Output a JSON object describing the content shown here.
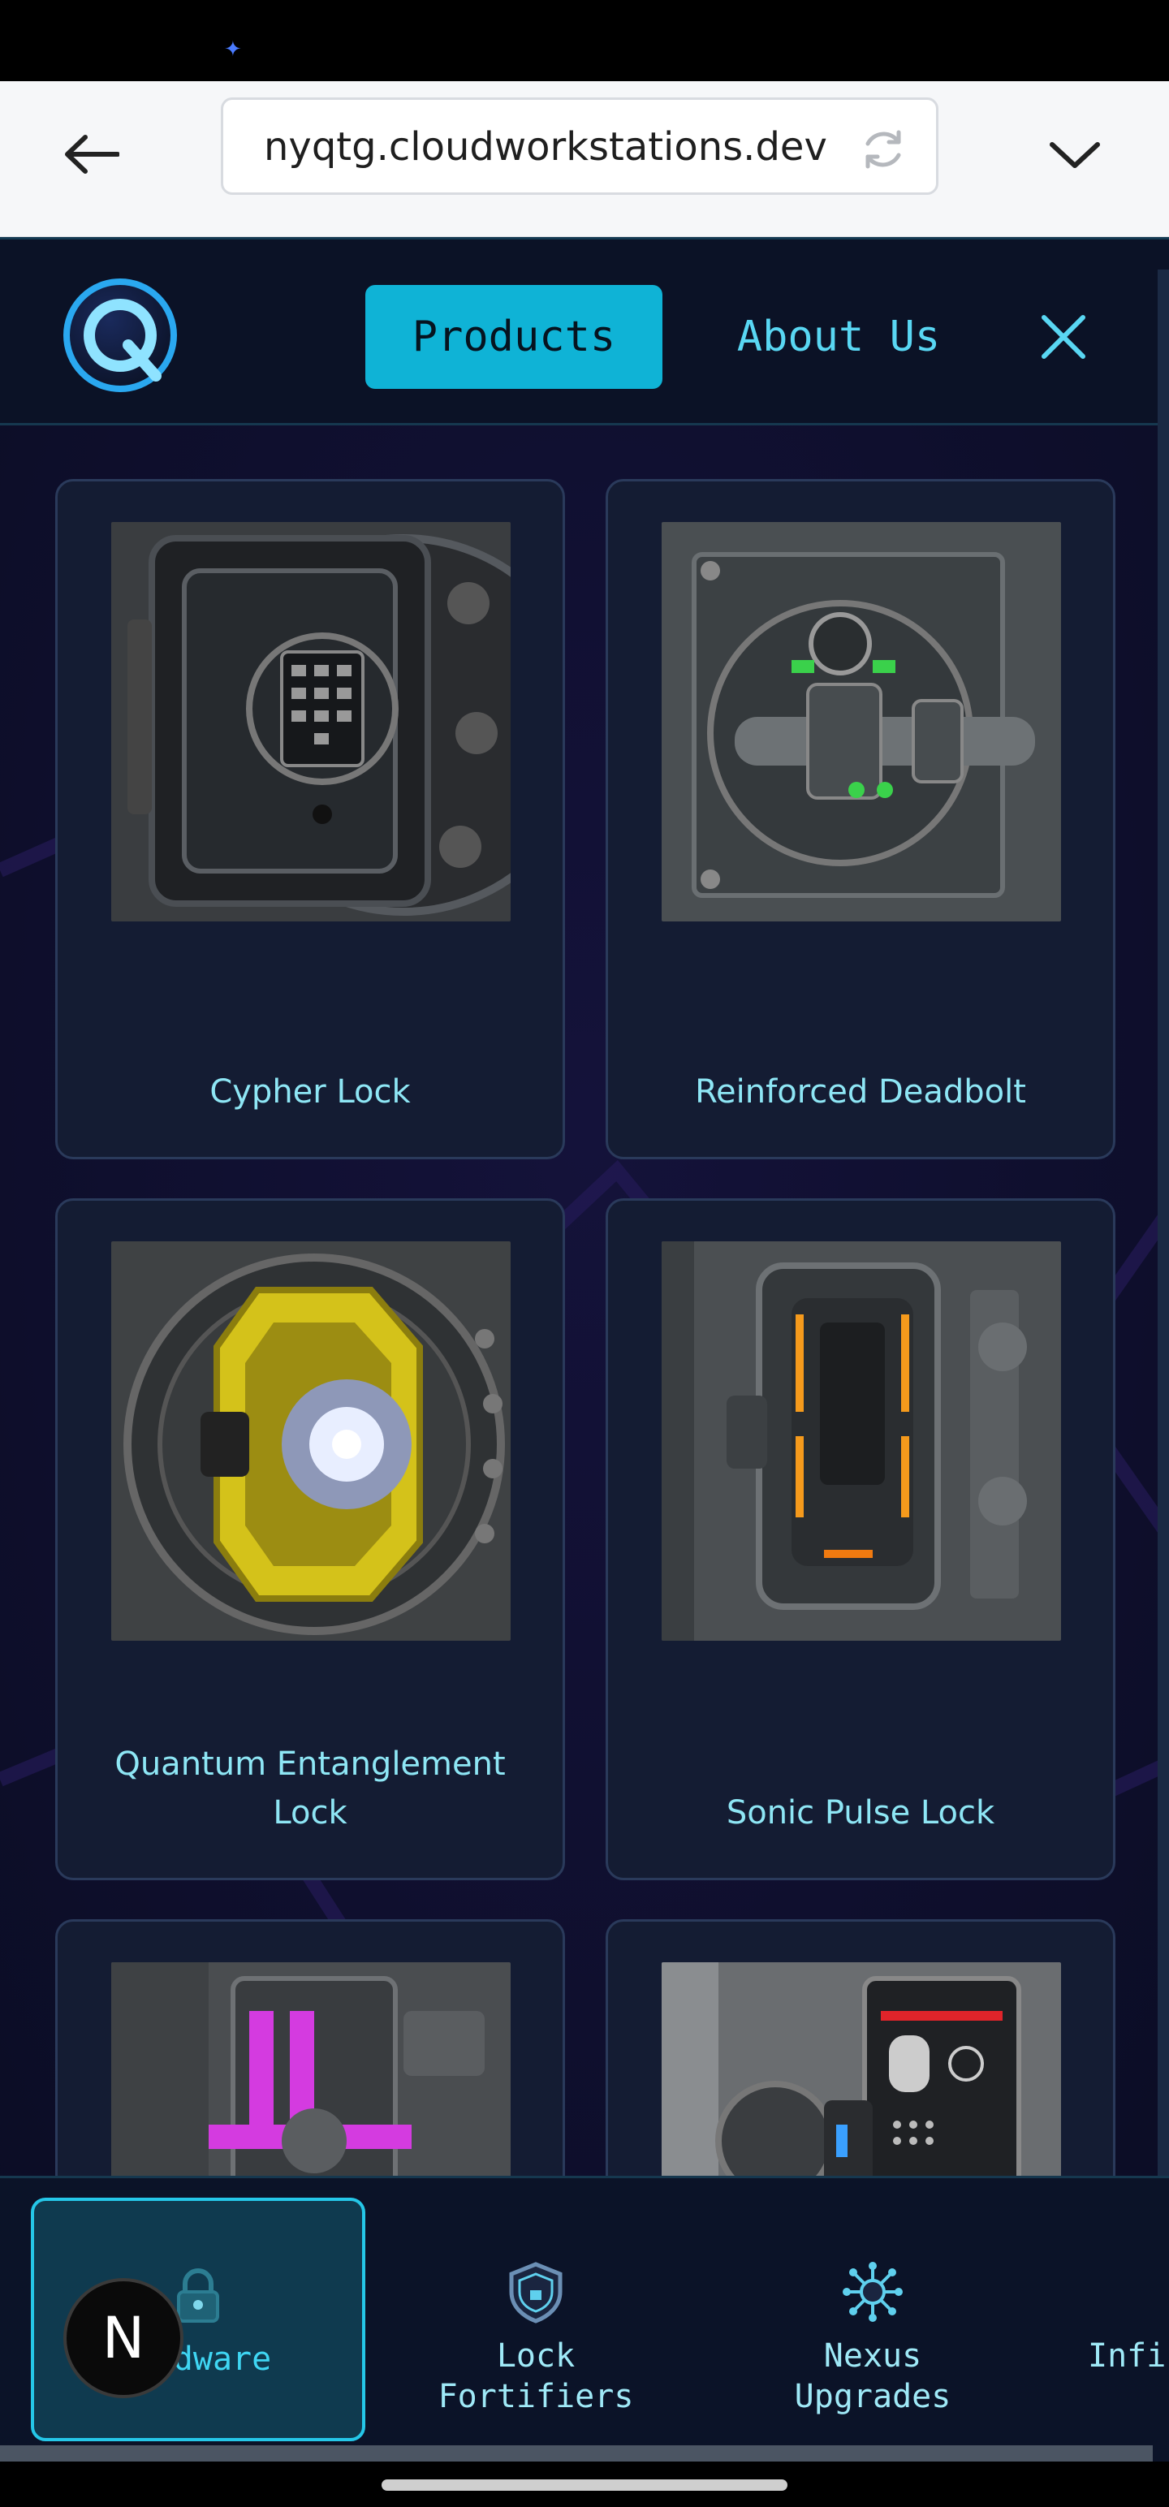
{
  "browser": {
    "url": "nyqtg.cloudworkstations.dev"
  },
  "nav": {
    "products": "Products",
    "about": "About Us"
  },
  "products": [
    {
      "title": "Cypher Lock"
    },
    {
      "title": "Reinforced Deadbolt"
    },
    {
      "title": "Quantum Entanglement Lock"
    },
    {
      "title": "Sonic Pulse Lock"
    },
    {
      "title": ""
    },
    {
      "title": ""
    }
  ],
  "tabs": [
    {
      "label": "dware",
      "icon": "padlock-icon"
    },
    {
      "label": "Lock\nFortifiers",
      "icon": "shield-icon"
    },
    {
      "label": "Nexus\nUpgrades",
      "icon": "network-icon"
    },
    {
      "label": "Infi",
      "icon": "none"
    }
  ],
  "avatar": {
    "letter": "N"
  },
  "colors": {
    "accent": "#0fb3d6",
    "background": "#0b0f24",
    "card": "#141c33",
    "title_text": "#8ee6f5"
  }
}
